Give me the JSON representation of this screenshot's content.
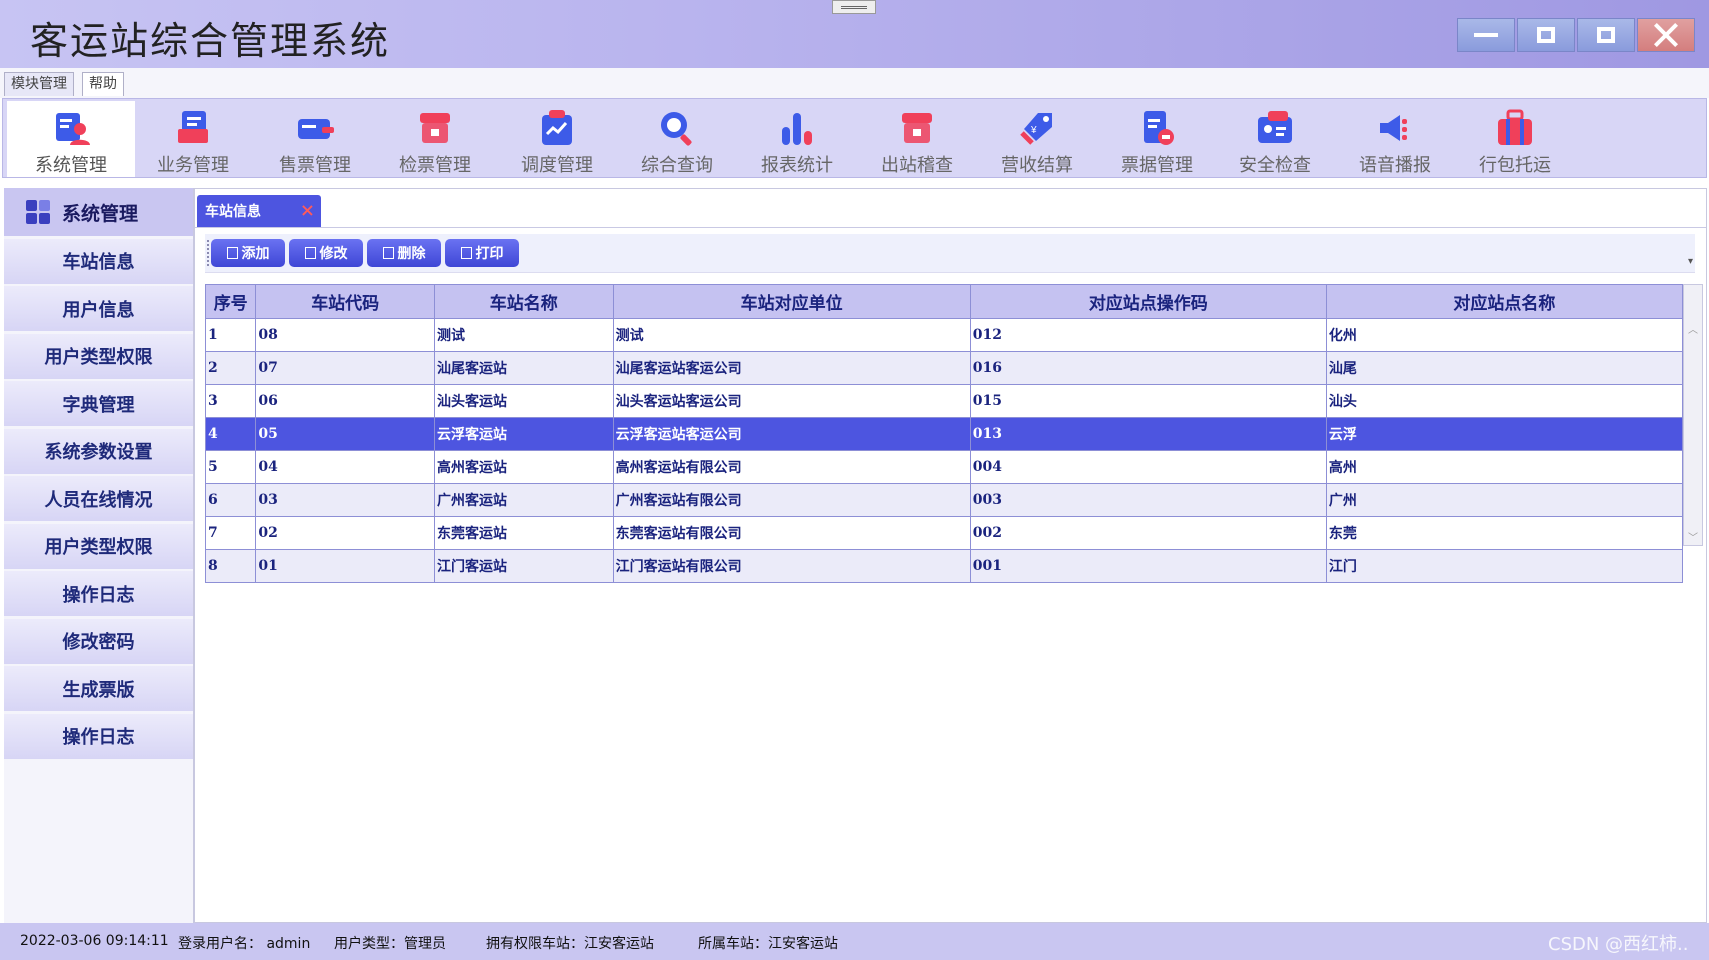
{
  "app": {
    "title": "客运站综合管理系统"
  },
  "menu": {
    "tabs": [
      "模块管理",
      "帮助"
    ]
  },
  "ribbon": {
    "items": [
      {
        "label": "系统管理",
        "icon": "system-management-icon"
      },
      {
        "label": "业务管理",
        "icon": "business-management-icon"
      },
      {
        "label": "售票管理",
        "icon": "ticket-sales-icon"
      },
      {
        "label": "检票管理",
        "icon": "ticket-check-icon"
      },
      {
        "label": "调度管理",
        "icon": "dispatch-icon"
      },
      {
        "label": "综合查询",
        "icon": "search-icon"
      },
      {
        "label": "报表统计",
        "icon": "report-chart-icon"
      },
      {
        "label": "出站稽查",
        "icon": "exit-inspection-icon"
      },
      {
        "label": "营收结算",
        "icon": "revenue-tag-icon"
      },
      {
        "label": "票据管理",
        "icon": "receipt-icon"
      },
      {
        "label": "安全检查",
        "icon": "security-check-icon"
      },
      {
        "label": "语音播报",
        "icon": "broadcast-icon"
      },
      {
        "label": "行包托运",
        "icon": "luggage-icon"
      }
    ],
    "active_index": 0
  },
  "sidebar": {
    "title": "系统管理",
    "items": [
      "车站信息",
      "用户信息",
      "用户类型权限",
      "字典管理",
      "系统参数设置",
      "人员在线情况",
      "用户类型权限",
      "操作日志",
      "修改密码",
      "生成票版",
      "操作日志"
    ]
  },
  "doc_tab": {
    "label": "车站信息",
    "close": "×"
  },
  "toolbar": {
    "add": "添加",
    "edit": "修改",
    "delete": "删除",
    "print": "打印"
  },
  "table": {
    "headers": [
      "序号",
      "车站代码",
      "车站名称",
      "车站对应单位",
      "对应站点操作码",
      "对应站点名称"
    ],
    "rows": [
      [
        "1",
        "08",
        "测试",
        "测试",
        "012",
        "化州"
      ],
      [
        "2",
        "07",
        "汕尾客运站",
        "汕尾客运站客运公司",
        "016",
        "汕尾"
      ],
      [
        "3",
        "06",
        "汕头客运站",
        "汕头客运站客运公司",
        "015",
        "汕头"
      ],
      [
        "4",
        "05",
        "云浮客运站",
        "云浮客运站客运公司",
        "013",
        "云浮"
      ],
      [
        "5",
        "04",
        "高州客运站",
        "高州客运站有限公司",
        "004",
        "高州"
      ],
      [
        "6",
        "03",
        "广州客运站",
        "广州客运站有限公司",
        "003",
        "广州"
      ],
      [
        "7",
        "02",
        "东莞客运站",
        "东莞客运站有限公司",
        "002",
        "东莞"
      ],
      [
        "8",
        "01",
        "江门客运站",
        "江门客运站有限公司",
        "001",
        "江门"
      ]
    ],
    "selected_row": 3
  },
  "status": {
    "datetime": "2022-03-06 09:14:11",
    "login_user": "登录用户名： admin",
    "user_type": "用户类型：管理员",
    "rights_station": "拥有权限车站：江安客运站",
    "home_station": "所属车站：江安客运站",
    "watermark": "CSDN @西红柿.."
  },
  "colors": {
    "accent": "#4d55e0",
    "header_bg": "#c5c2f1",
    "icon_blue": "#3d5be8",
    "icon_red": "#f0405a"
  }
}
